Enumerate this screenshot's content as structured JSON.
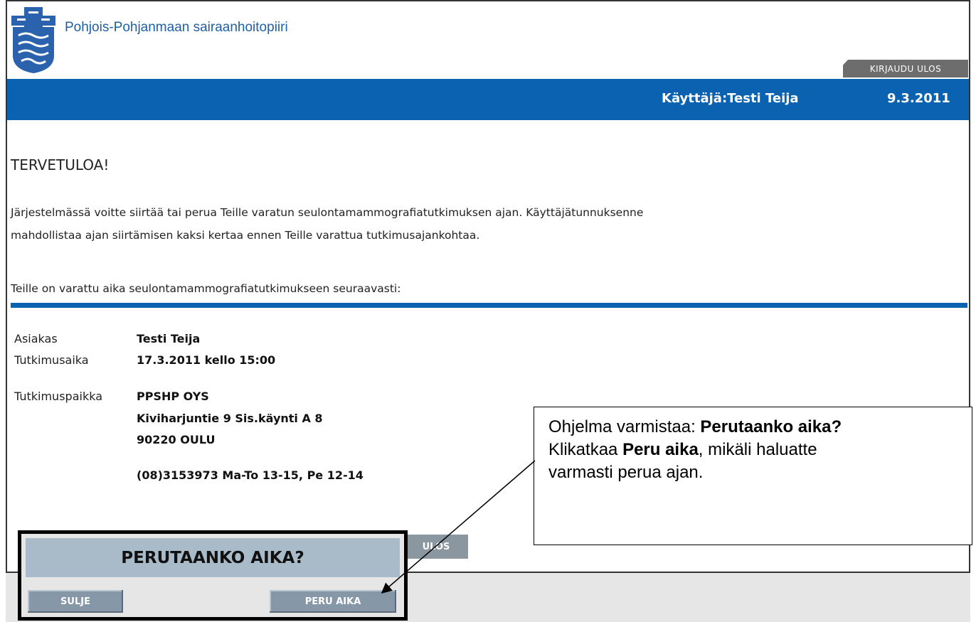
{
  "header": {
    "org_name": "Pohjois-Pohjanmaan sairaanhoitopiiri",
    "logout_label": "KIRJAUDU ULOS",
    "user_label": "Käyttäjä:Testi Teija",
    "date": "9.3.2011"
  },
  "main": {
    "welcome": "TERVETULOA!",
    "intro_line1": "Järjestelmässä voitte siirtää tai perua Teille varatun seulontamammografiatutkimuksen ajan. Käyttäjätunnuksenne",
    "intro_line2": "mahdollistaa ajan siirtämisen kaksi kertaa ennen Teille varattua tutkimusajankohtaa.",
    "reserved_text": "Teille on varattu aika seulontamammografiatutkimukseen seuraavasti:",
    "details": {
      "client_label": "Asiakas",
      "client_value": "Testi Teija",
      "time_label": "Tutkimusaika",
      "time_value": "17.3.2011 kello 15:00",
      "place_label": "Tutkimuspaikka",
      "place_line1": "PPSHP OYS",
      "place_line2": "Kiviharjuntie 9 Sis.käynti A 8",
      "place_line3": "90220 OULU",
      "phone": "(08)3153973 Ma-To 13-15, Pe 12-14"
    },
    "partial_button": "ULOS"
  },
  "dialog": {
    "title": "PERUTAANKO AIKA?",
    "close_label": "SULJE",
    "cancel_label": "PERU AIKA"
  },
  "callout": {
    "line1_prefix": "Ohjelma varmistaa: ",
    "line1_bold": "Perutaanko aika?",
    "line2_prefix": "Klikatkaa ",
    "line2_bold": "Peru aika",
    "line2_suffix": ", mikäli haluatte",
    "line3": "varmasti perua ajan."
  },
  "colors": {
    "brand_blue": "#0b62b0",
    "dialog_title_bg": "#a9bac9",
    "button_bg": "#8698a8"
  }
}
